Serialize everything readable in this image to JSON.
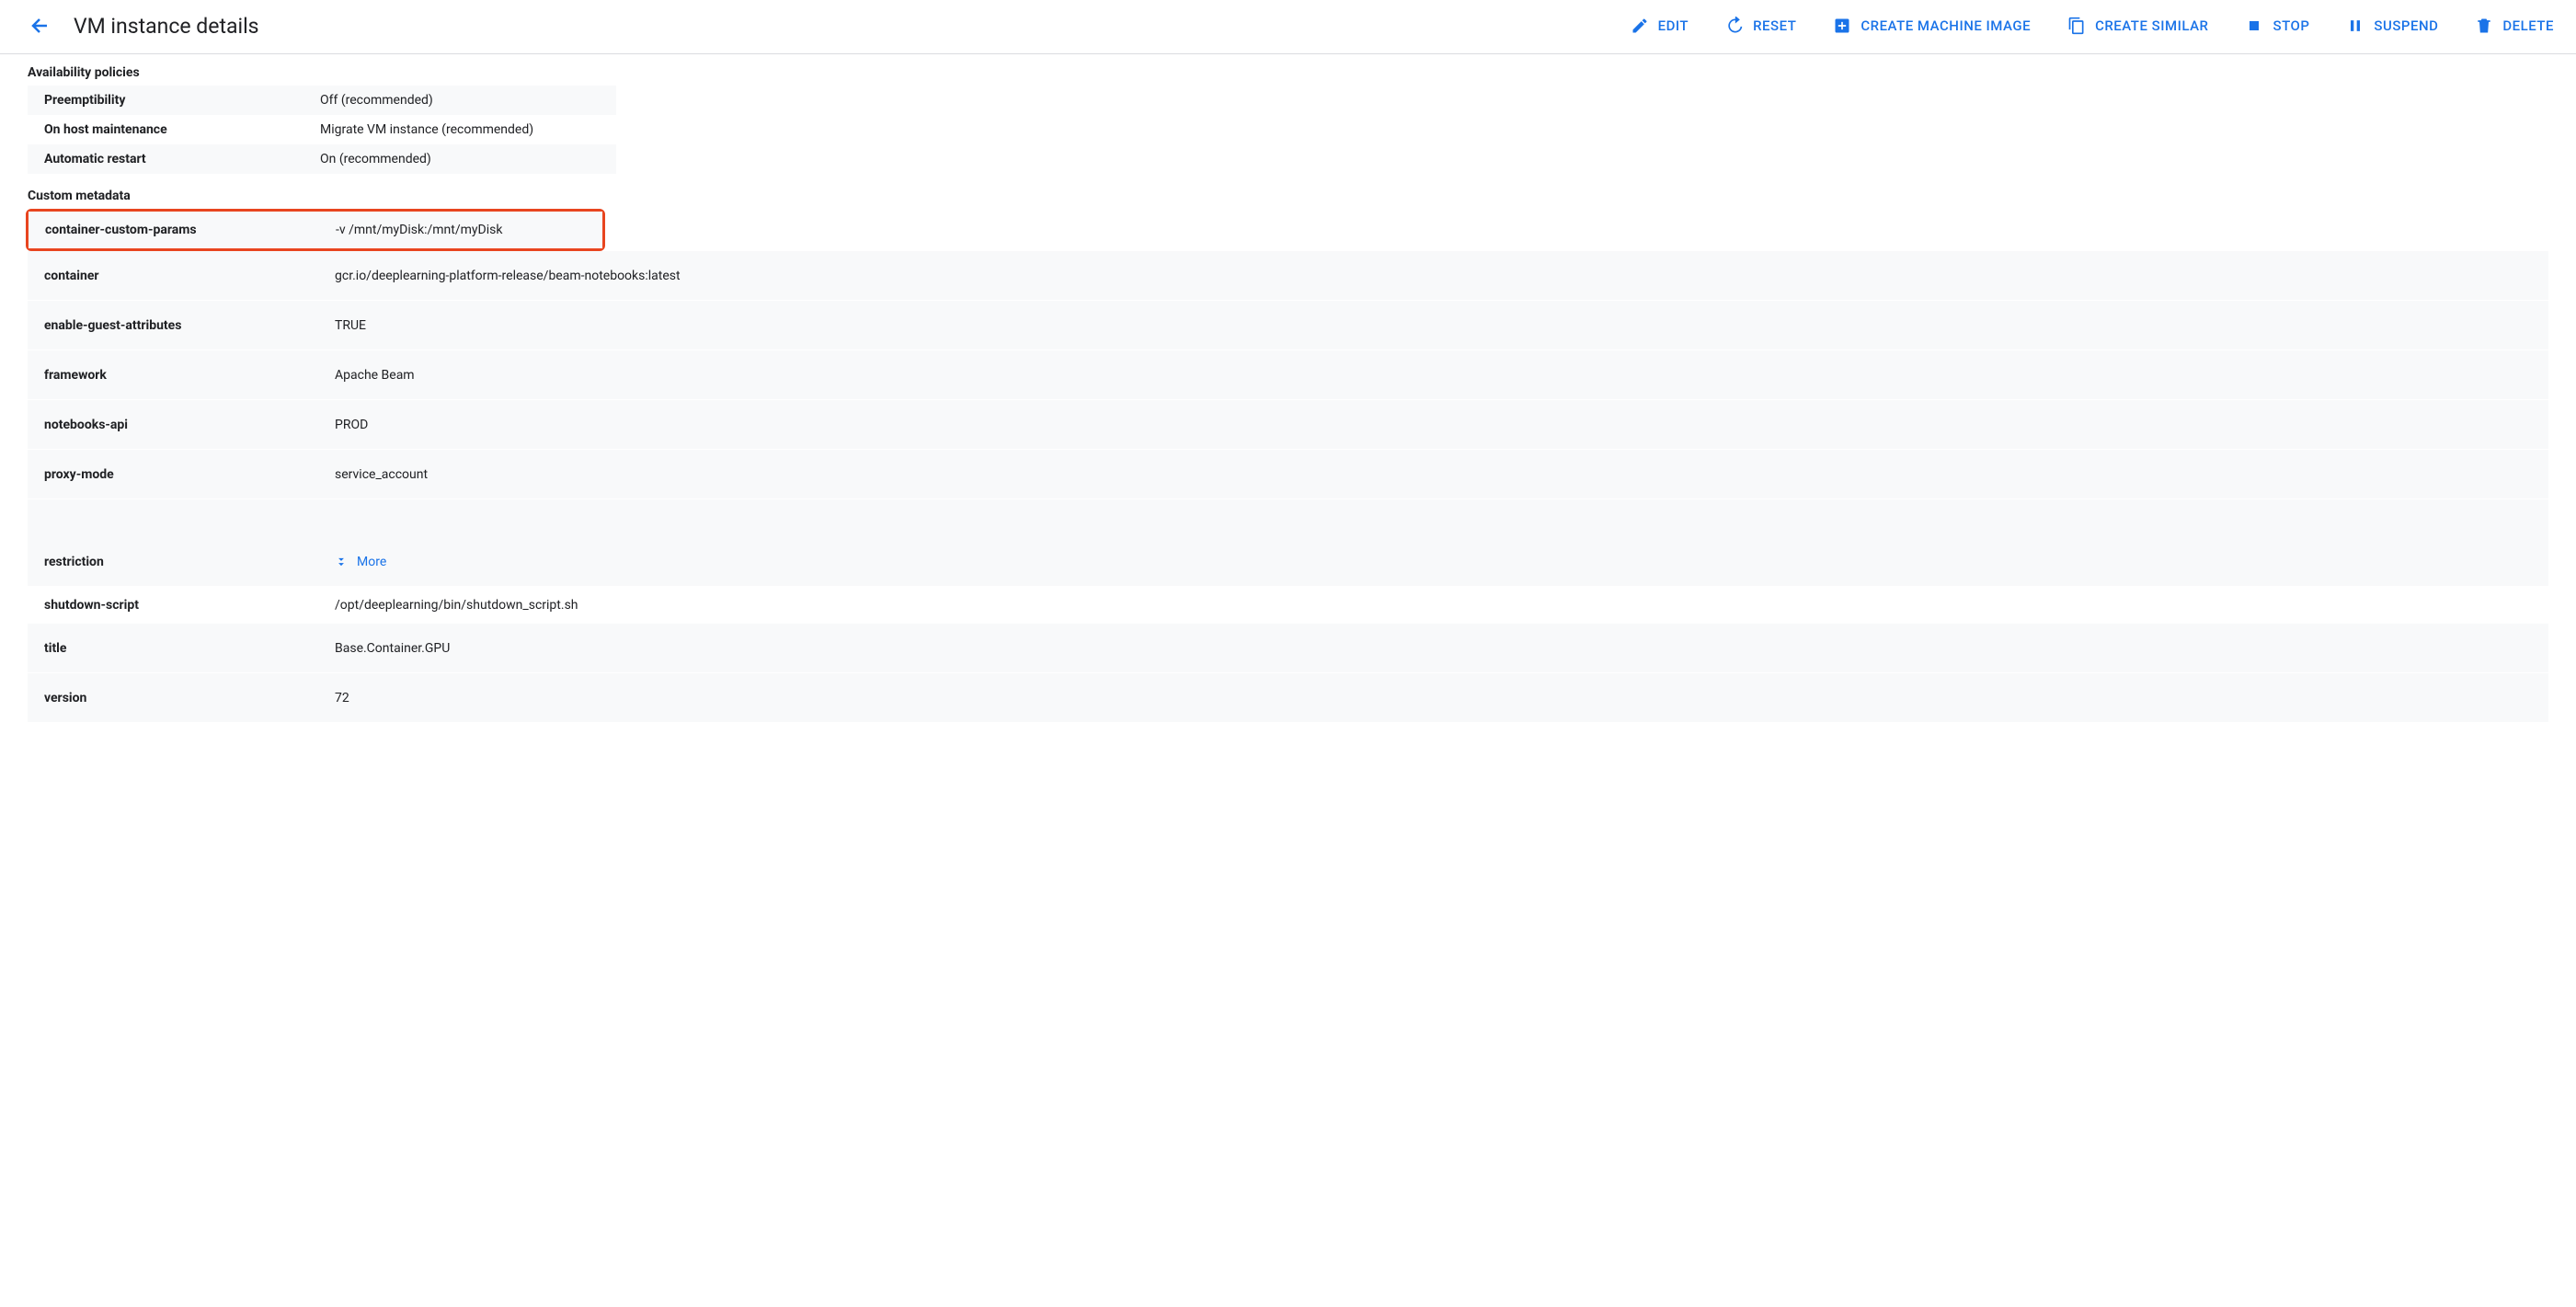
{
  "header": {
    "title": "VM instance details",
    "actions": {
      "edit": "EDIT",
      "reset": "RESET",
      "create_machine_image": "CREATE MACHINE IMAGE",
      "create_similar": "CREATE SIMILAR",
      "stop": "STOP",
      "suspend": "SUSPEND",
      "delete": "DELETE"
    }
  },
  "availability": {
    "title": "Availability policies",
    "rows": [
      {
        "k": "Preemptibility",
        "v": "Off (recommended)"
      },
      {
        "k": "On host maintenance",
        "v": "Migrate VM instance (recommended)"
      },
      {
        "k": "Automatic restart",
        "v": "On (recommended)"
      }
    ]
  },
  "metadata": {
    "title": "Custom metadata",
    "highlighted": {
      "k": "container-custom-params",
      "v": "-v /mnt/myDisk:/mnt/myDisk"
    },
    "rows": [
      {
        "k": "container",
        "v": "gcr.io/deeplearning-platform-release/beam-notebooks:latest"
      },
      {
        "k": "enable-guest-attributes",
        "v": "TRUE"
      },
      {
        "k": "framework",
        "v": "Apache Beam"
      },
      {
        "k": "notebooks-api",
        "v": "PROD"
      },
      {
        "k": "proxy-mode",
        "v": "service_account"
      }
    ],
    "restriction_key": "restriction",
    "more_label": "More",
    "tail": [
      {
        "k": "shutdown-script",
        "v": "/opt/deeplearning/bin/shutdown_script.sh"
      },
      {
        "k": "title",
        "v": "Base.Container.GPU"
      },
      {
        "k": "version",
        "v": "72"
      }
    ]
  }
}
